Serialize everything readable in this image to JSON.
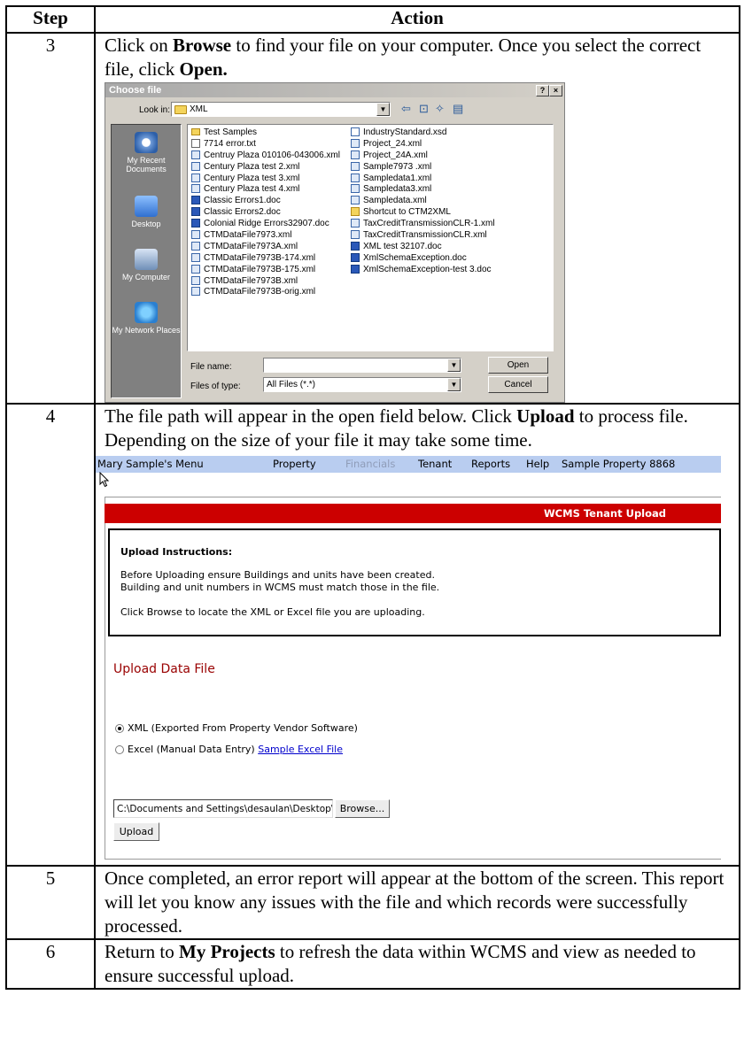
{
  "headers": {
    "step": "Step",
    "action": "Action"
  },
  "rows": [
    {
      "step": "3",
      "p1a": "Click on ",
      "p1b": "Browse",
      "p1c": " to find your file on your computer. Once you select the correct file, click ",
      "p1d": "Open."
    },
    {
      "step": "4",
      "p1a": "The file path will appear in the open field below.  Click ",
      "p1b": "Upload",
      "p1c": " to process file.  Depending on the size of your file it may take some time."
    },
    {
      "step": "5",
      "text": "Once completed, an error report will appear at the bottom of the screen.  This report will let you know any issues with the file and which records were successfully processed."
    },
    {
      "step": "6",
      "p1a": "Return to ",
      "p1b": "My Projects",
      "p1c": " to refresh the data within WCMS and view as needed to ensure successful upload."
    }
  ],
  "dialog": {
    "title": "Choose file",
    "help_btn": "?",
    "close_btn": "×",
    "look_in_label": "Look in:",
    "look_in_value": "XML",
    "places": [
      "My Recent Documents",
      "Desktop",
      "My Computer",
      "My Network Places"
    ],
    "files_col1": [
      {
        "name": "Test Samples",
        "type": "folder"
      },
      {
        "name": "7714 error.txt",
        "type": "txt"
      },
      {
        "name": "Centruy Plaza 010106-043006.xml",
        "type": "xml"
      },
      {
        "name": "Century Plaza test 2.xml",
        "type": "xml"
      },
      {
        "name": "Century Plaza test 3.xml",
        "type": "xml"
      },
      {
        "name": "Century Plaza test 4.xml",
        "type": "xml"
      },
      {
        "name": "Classic Errors1.doc",
        "type": "doc"
      },
      {
        "name": "Classic Errors2.doc",
        "type": "doc"
      },
      {
        "name": "Colonial Ridge Errors32907.doc",
        "type": "doc"
      },
      {
        "name": "CTMDataFile7973.xml",
        "type": "xml"
      },
      {
        "name": "CTMDataFile7973A.xml",
        "type": "xml"
      },
      {
        "name": "CTMDataFile7973B-174.xml",
        "type": "xml"
      },
      {
        "name": "CTMDataFile7973B-175.xml",
        "type": "xml"
      },
      {
        "name": "CTMDataFile7973B.xml",
        "type": "xml"
      },
      {
        "name": "CTMDataFile7973B-orig.xml",
        "type": "xml"
      }
    ],
    "files_col2": [
      {
        "name": "IndustryStandard.xsd",
        "type": "xsd"
      },
      {
        "name": "Project_24.xml",
        "type": "xml"
      },
      {
        "name": "Project_24A.xml",
        "type": "xml"
      },
      {
        "name": "Sample7973 .xml",
        "type": "xml"
      },
      {
        "name": "Sampledata1.xml",
        "type": "xml"
      },
      {
        "name": "Sampledata3.xml",
        "type": "xml"
      },
      {
        "name": "Sampledata.xml",
        "type": "xml"
      },
      {
        "name": "Shortcut to CTM2XML",
        "type": "lnk"
      },
      {
        "name": "TaxCreditTransmissionCLR-1.xml",
        "type": "xml"
      },
      {
        "name": "TaxCreditTransmissionCLR.xml",
        "type": "xml"
      },
      {
        "name": "XML test 32107.doc",
        "type": "doc"
      },
      {
        "name": "XmlSchemaException.doc",
        "type": "doc"
      },
      {
        "name": "XmlSchemaException-test 3.doc",
        "type": "doc"
      }
    ],
    "file_name_label": "File name:",
    "file_name_value": "",
    "files_of_type_label": "Files of type:",
    "files_of_type_value": "All Files (*.*)",
    "open_btn": "Open",
    "cancel_btn": "Cancel"
  },
  "web": {
    "menu": [
      "Mary Sample's Menu",
      "Property",
      "Financials",
      "Tenant",
      "Reports",
      "Help",
      "Sample Property 8868"
    ],
    "banner": "WCMS Tenant Upload",
    "instr_title": "Upload Instructions:",
    "instr_line1": "Before Uploading ensure Buildings and units have been created.",
    "instr_line2": "Building and unit numbers in WCMS must match those in the file.",
    "instr_line3": "Click Browse to locate the XML or Excel file you are uploading.",
    "section_title": "Upload Data File",
    "radio_xml": "XML (Exported From Property Vendor Software)",
    "radio_excel": "Excel (Manual Data Entry) ",
    "sample_link": "Sample Excel File",
    "path_value": "C:\\Documents and Settings\\desaulan\\Desktop\\",
    "browse_btn": "Browse...",
    "upload_btn": "Upload"
  }
}
